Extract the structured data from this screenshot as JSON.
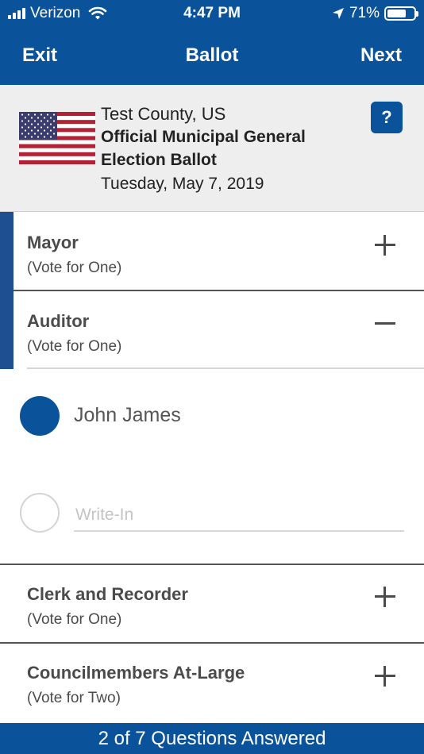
{
  "status_bar": {
    "carrier": "Verizon",
    "time": "4:47 PM",
    "battery_text": "71%",
    "battery_level": 0.71,
    "icons": [
      "signal-icon",
      "wifi-icon",
      "location-arrow-icon",
      "battery-icon"
    ]
  },
  "nav": {
    "exit_label": "Exit",
    "title": "Ballot",
    "next_label": "Next"
  },
  "ballot_header": {
    "county": "Test County, US",
    "title": "Official Municipal General Election Ballot",
    "date": "Tuesday, May 7, 2019",
    "help_label": "?",
    "flag": "us-flag"
  },
  "contests": [
    {
      "name": "Mayor",
      "instruction": "(Vote for One)",
      "expanded": false
    },
    {
      "name": "Auditor",
      "instruction": "(Vote for One)",
      "expanded": true
    },
    {
      "name": "Clerk and Recorder",
      "instruction": "(Vote for One)",
      "expanded": false
    },
    {
      "name": "Councilmembers At-Large",
      "instruction": "(Vote for Two)",
      "expanded": false
    }
  ],
  "auditor_options": {
    "candidate": {
      "name": "John James",
      "selected": true
    },
    "write_in": {
      "placeholder": "Write-In",
      "value": "",
      "selected": false
    }
  },
  "footer": {
    "progress_text": "2 of 7 Questions Answered"
  },
  "colors": {
    "brand_blue": "#0a539b",
    "accent_bar": "#1d4f91",
    "header_bg": "#eeeeee"
  }
}
